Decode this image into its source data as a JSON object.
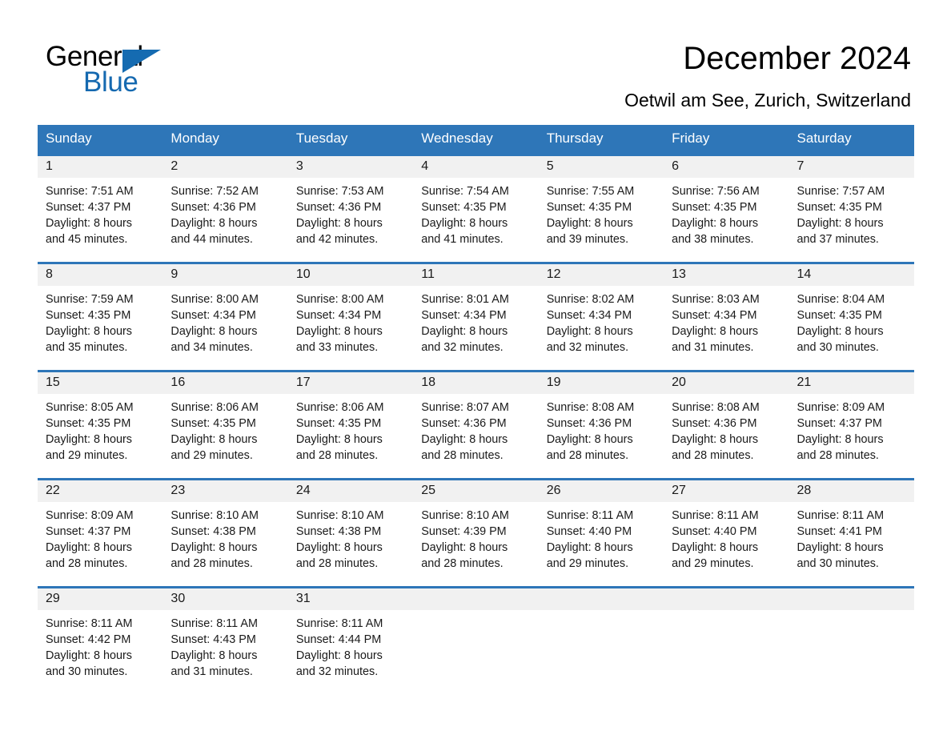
{
  "brand": {
    "name_part1": "General",
    "name_part2": "Blue",
    "accent_color": "#1569b0"
  },
  "header": {
    "title": "December 2024",
    "subtitle": "Oetwil am See, Zurich, Switzerland"
  },
  "calendar": {
    "header_bg": "#2e76b8",
    "day_band_bg": "#f1f1f1",
    "weekday_headers": [
      "Sunday",
      "Monday",
      "Tuesday",
      "Wednesday",
      "Thursday",
      "Friday",
      "Saturday"
    ],
    "weeks": [
      [
        {
          "day": "1",
          "sunrise": "Sunrise: 7:51 AM",
          "sunset": "Sunset: 4:37 PM",
          "daylight_line1": "Daylight: 8 hours",
          "daylight_line2": "and 45 minutes."
        },
        {
          "day": "2",
          "sunrise": "Sunrise: 7:52 AM",
          "sunset": "Sunset: 4:36 PM",
          "daylight_line1": "Daylight: 8 hours",
          "daylight_line2": "and 44 minutes."
        },
        {
          "day": "3",
          "sunrise": "Sunrise: 7:53 AM",
          "sunset": "Sunset: 4:36 PM",
          "daylight_line1": "Daylight: 8 hours",
          "daylight_line2": "and 42 minutes."
        },
        {
          "day": "4",
          "sunrise": "Sunrise: 7:54 AM",
          "sunset": "Sunset: 4:35 PM",
          "daylight_line1": "Daylight: 8 hours",
          "daylight_line2": "and 41 minutes."
        },
        {
          "day": "5",
          "sunrise": "Sunrise: 7:55 AM",
          "sunset": "Sunset: 4:35 PM",
          "daylight_line1": "Daylight: 8 hours",
          "daylight_line2": "and 39 minutes."
        },
        {
          "day": "6",
          "sunrise": "Sunrise: 7:56 AM",
          "sunset": "Sunset: 4:35 PM",
          "daylight_line1": "Daylight: 8 hours",
          "daylight_line2": "and 38 minutes."
        },
        {
          "day": "7",
          "sunrise": "Sunrise: 7:57 AM",
          "sunset": "Sunset: 4:35 PM",
          "daylight_line1": "Daylight: 8 hours",
          "daylight_line2": "and 37 minutes."
        }
      ],
      [
        {
          "day": "8",
          "sunrise": "Sunrise: 7:59 AM",
          "sunset": "Sunset: 4:35 PM",
          "daylight_line1": "Daylight: 8 hours",
          "daylight_line2": "and 35 minutes."
        },
        {
          "day": "9",
          "sunrise": "Sunrise: 8:00 AM",
          "sunset": "Sunset: 4:34 PM",
          "daylight_line1": "Daylight: 8 hours",
          "daylight_line2": "and 34 minutes."
        },
        {
          "day": "10",
          "sunrise": "Sunrise: 8:00 AM",
          "sunset": "Sunset: 4:34 PM",
          "daylight_line1": "Daylight: 8 hours",
          "daylight_line2": "and 33 minutes."
        },
        {
          "day": "11",
          "sunrise": "Sunrise: 8:01 AM",
          "sunset": "Sunset: 4:34 PM",
          "daylight_line1": "Daylight: 8 hours",
          "daylight_line2": "and 32 minutes."
        },
        {
          "day": "12",
          "sunrise": "Sunrise: 8:02 AM",
          "sunset": "Sunset: 4:34 PM",
          "daylight_line1": "Daylight: 8 hours",
          "daylight_line2": "and 32 minutes."
        },
        {
          "day": "13",
          "sunrise": "Sunrise: 8:03 AM",
          "sunset": "Sunset: 4:34 PM",
          "daylight_line1": "Daylight: 8 hours",
          "daylight_line2": "and 31 minutes."
        },
        {
          "day": "14",
          "sunrise": "Sunrise: 8:04 AM",
          "sunset": "Sunset: 4:35 PM",
          "daylight_line1": "Daylight: 8 hours",
          "daylight_line2": "and 30 minutes."
        }
      ],
      [
        {
          "day": "15",
          "sunrise": "Sunrise: 8:05 AM",
          "sunset": "Sunset: 4:35 PM",
          "daylight_line1": "Daylight: 8 hours",
          "daylight_line2": "and 29 minutes."
        },
        {
          "day": "16",
          "sunrise": "Sunrise: 8:06 AM",
          "sunset": "Sunset: 4:35 PM",
          "daylight_line1": "Daylight: 8 hours",
          "daylight_line2": "and 29 minutes."
        },
        {
          "day": "17",
          "sunrise": "Sunrise: 8:06 AM",
          "sunset": "Sunset: 4:35 PM",
          "daylight_line1": "Daylight: 8 hours",
          "daylight_line2": "and 28 minutes."
        },
        {
          "day": "18",
          "sunrise": "Sunrise: 8:07 AM",
          "sunset": "Sunset: 4:36 PM",
          "daylight_line1": "Daylight: 8 hours",
          "daylight_line2": "and 28 minutes."
        },
        {
          "day": "19",
          "sunrise": "Sunrise: 8:08 AM",
          "sunset": "Sunset: 4:36 PM",
          "daylight_line1": "Daylight: 8 hours",
          "daylight_line2": "and 28 minutes."
        },
        {
          "day": "20",
          "sunrise": "Sunrise: 8:08 AM",
          "sunset": "Sunset: 4:36 PM",
          "daylight_line1": "Daylight: 8 hours",
          "daylight_line2": "and 28 minutes."
        },
        {
          "day": "21",
          "sunrise": "Sunrise: 8:09 AM",
          "sunset": "Sunset: 4:37 PM",
          "daylight_line1": "Daylight: 8 hours",
          "daylight_line2": "and 28 minutes."
        }
      ],
      [
        {
          "day": "22",
          "sunrise": "Sunrise: 8:09 AM",
          "sunset": "Sunset: 4:37 PM",
          "daylight_line1": "Daylight: 8 hours",
          "daylight_line2": "and 28 minutes."
        },
        {
          "day": "23",
          "sunrise": "Sunrise: 8:10 AM",
          "sunset": "Sunset: 4:38 PM",
          "daylight_line1": "Daylight: 8 hours",
          "daylight_line2": "and 28 minutes."
        },
        {
          "day": "24",
          "sunrise": "Sunrise: 8:10 AM",
          "sunset": "Sunset: 4:38 PM",
          "daylight_line1": "Daylight: 8 hours",
          "daylight_line2": "and 28 minutes."
        },
        {
          "day": "25",
          "sunrise": "Sunrise: 8:10 AM",
          "sunset": "Sunset: 4:39 PM",
          "daylight_line1": "Daylight: 8 hours",
          "daylight_line2": "and 28 minutes."
        },
        {
          "day": "26",
          "sunrise": "Sunrise: 8:11 AM",
          "sunset": "Sunset: 4:40 PM",
          "daylight_line1": "Daylight: 8 hours",
          "daylight_line2": "and 29 minutes."
        },
        {
          "day": "27",
          "sunrise": "Sunrise: 8:11 AM",
          "sunset": "Sunset: 4:40 PM",
          "daylight_line1": "Daylight: 8 hours",
          "daylight_line2": "and 29 minutes."
        },
        {
          "day": "28",
          "sunrise": "Sunrise: 8:11 AM",
          "sunset": "Sunset: 4:41 PM",
          "daylight_line1": "Daylight: 8 hours",
          "daylight_line2": "and 30 minutes."
        }
      ],
      [
        {
          "day": "29",
          "sunrise": "Sunrise: 8:11 AM",
          "sunset": "Sunset: 4:42 PM",
          "daylight_line1": "Daylight: 8 hours",
          "daylight_line2": "and 30 minutes."
        },
        {
          "day": "30",
          "sunrise": "Sunrise: 8:11 AM",
          "sunset": "Sunset: 4:43 PM",
          "daylight_line1": "Daylight: 8 hours",
          "daylight_line2": "and 31 minutes."
        },
        {
          "day": "31",
          "sunrise": "Sunrise: 8:11 AM",
          "sunset": "Sunset: 4:44 PM",
          "daylight_line1": "Daylight: 8 hours",
          "daylight_line2": "and 32 minutes."
        },
        {
          "day": "",
          "sunrise": "",
          "sunset": "",
          "daylight_line1": "",
          "daylight_line2": ""
        },
        {
          "day": "",
          "sunrise": "",
          "sunset": "",
          "daylight_line1": "",
          "daylight_line2": ""
        },
        {
          "day": "",
          "sunrise": "",
          "sunset": "",
          "daylight_line1": "",
          "daylight_line2": ""
        },
        {
          "day": "",
          "sunrise": "",
          "sunset": "",
          "daylight_line1": "",
          "daylight_line2": ""
        }
      ]
    ]
  }
}
